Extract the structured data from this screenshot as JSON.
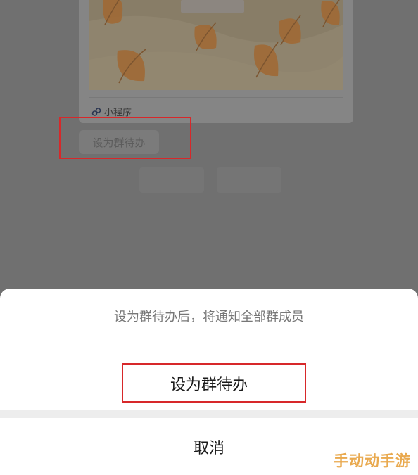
{
  "card": {
    "source_label": "小程序",
    "source_icon": "mini-program-icon"
  },
  "chat": {
    "set_todo_label": "设为群待办"
  },
  "sheet": {
    "prompt": "设为群待办后，将通知全部群成员",
    "confirm_label": "设为群待办",
    "cancel_label": "取消"
  },
  "watermark": {
    "text": "手动动手游"
  },
  "colors": {
    "highlight": "#d7282a",
    "leaf": "#c27a2e",
    "watermark": "#e9a94e"
  }
}
